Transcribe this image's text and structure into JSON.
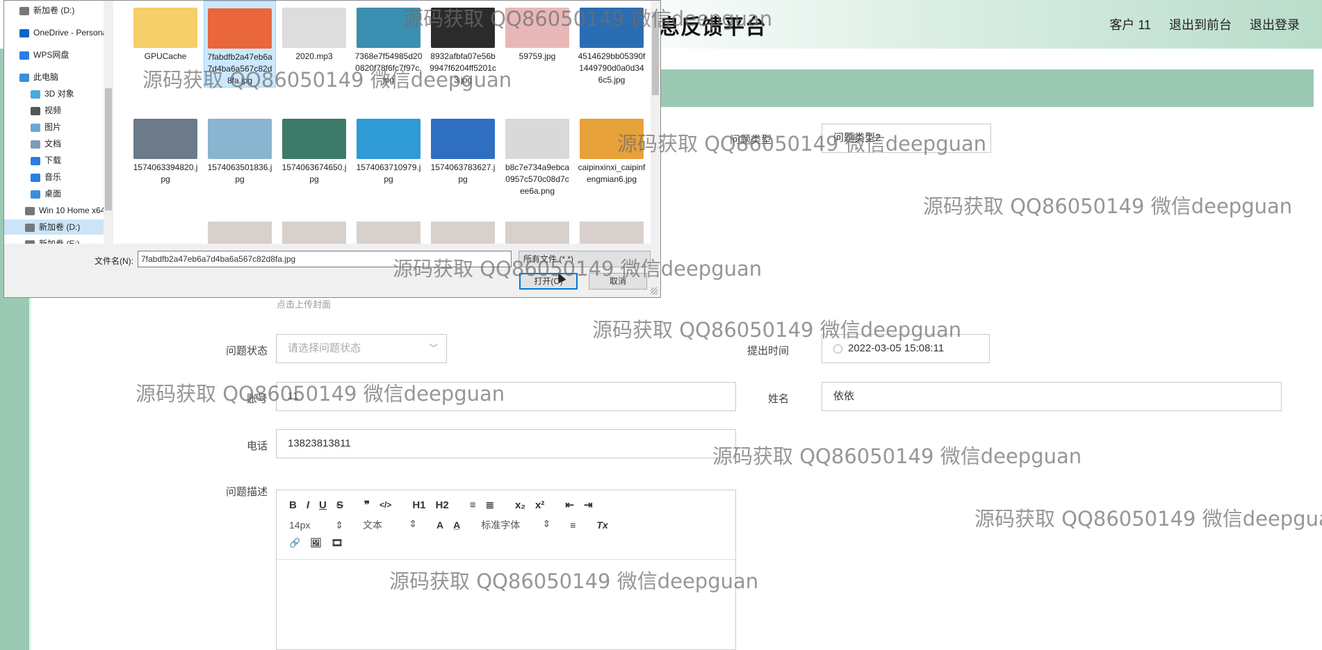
{
  "header": {
    "title": "息反馈平台",
    "nav": [
      "客户 11",
      "退出到前台",
      "退出登录"
    ]
  },
  "form": {
    "category_label": "问题类型",
    "category_value": "问题类型2",
    "upload_hint": "点击上传封面",
    "status_label": "问题状态",
    "status_placeholder": "请选择问题状态",
    "time_label": "提出时间",
    "time_value": "2022-03-05 15:08:11",
    "account_label": "账号",
    "account_value": "11",
    "name_label": "姓名",
    "name_value": "依依",
    "phone_label": "电话",
    "phone_value": "13823813811",
    "desc_label": "问题描述"
  },
  "editor": {
    "row1": [
      "B",
      "I",
      "U",
      "S",
      "❞",
      "</>",
      "H1",
      "H2",
      "≡",
      "≣",
      "x₂",
      "x²",
      "⇤",
      "⇥"
    ],
    "font_size": "14px",
    "text_style": "文本",
    "font_family": "标准字体",
    "row2_icons": [
      "A",
      "A̲",
      "≡",
      "Tx"
    ],
    "row3_icons": [
      "🔗",
      "🖼",
      "🎞"
    ]
  },
  "dialog": {
    "nav": [
      {
        "label": "新加卷 (D:)",
        "icon": "drive-icon",
        "color": "#777777"
      },
      {
        "label": "OneDrive - Personal",
        "icon": "cloud-icon",
        "color": "#0a64c8"
      },
      {
        "label": "WPS网盘",
        "icon": "cloud-icon",
        "color": "#2a7de1"
      },
      {
        "label": "此电脑",
        "icon": "computer-icon",
        "color": "#3a8fd8"
      },
      {
        "label": "3D 对象",
        "icon": "cube-icon",
        "color": "#49a9e0"
      },
      {
        "label": "视频",
        "icon": "video-icon",
        "color": "#555555"
      },
      {
        "label": "图片",
        "icon": "picture-icon",
        "color": "#6aa7d8"
      },
      {
        "label": "文档",
        "icon": "document-icon",
        "color": "#7d9bb8"
      },
      {
        "label": "下载",
        "icon": "download-icon",
        "color": "#2a7de1"
      },
      {
        "label": "音乐",
        "icon": "music-icon",
        "color": "#2a7de1"
      },
      {
        "label": "桌面",
        "icon": "desktop-icon",
        "color": "#3a8fd8"
      },
      {
        "label": "Win 10 Home x64",
        "icon": "drive-icon",
        "color": "#777777"
      },
      {
        "label": "新加卷 (D:)",
        "icon": "drive-icon",
        "color": "#777777"
      },
      {
        "label": "新加卷 (E:)",
        "icon": "drive-icon",
        "color": "#777777"
      }
    ],
    "files_row1": [
      {
        "name": "GPUCache",
        "color": "#f4cf6a"
      },
      {
        "name": "7fabdfb2a47eb6a7d4ba6a567c82d8fa.jpg",
        "color": "#e9673a"
      },
      {
        "name": "2020.mp3",
        "color": "#dddddd"
      },
      {
        "name": "7368e7f54985d200820f78f6fc7f97c.jpg",
        "color": "#3b8fb0"
      },
      {
        "name": "8932afbfa07e56b9947f6204ff5201c3.jpg",
        "color": "#2b2b2b"
      },
      {
        "name": "59759.jpg",
        "color": "#e8b8b8"
      },
      {
        "name": "4514629bb05390f1449790d0a0d346c5.jpg",
        "color": "#2a6db3"
      }
    ],
    "files_row2": [
      {
        "name": "1574063394820.jpg",
        "color": "#6c7a89"
      },
      {
        "name": "1574063501836.jpg",
        "color": "#8ab4cf"
      },
      {
        "name": "1574063674650.jpg",
        "color": "#3d7a6a"
      },
      {
        "name": "1574063710979.jpg",
        "color": "#2f9bd6"
      },
      {
        "name": "1574063783627.jpg",
        "color": "#2e6fc2"
      },
      {
        "name": "b8c7e734a9ebca0957c570c08d7cee6a.png",
        "color": "#d9d9d9"
      },
      {
        "name": "caipinxinxi_caipinfengmian6.jpg",
        "color": "#e8a23a"
      }
    ],
    "filename_label": "文件名(N):",
    "filename_value": "7fabdfb2a47eb6a7d4ba6a567c82d8fa.jpg",
    "filetype_value": "所有文件 (*.*)",
    "open_label": "打开(O)",
    "cancel_label": "取消"
  },
  "watermark": "源码获取 QQ86050149 微信deepguan"
}
